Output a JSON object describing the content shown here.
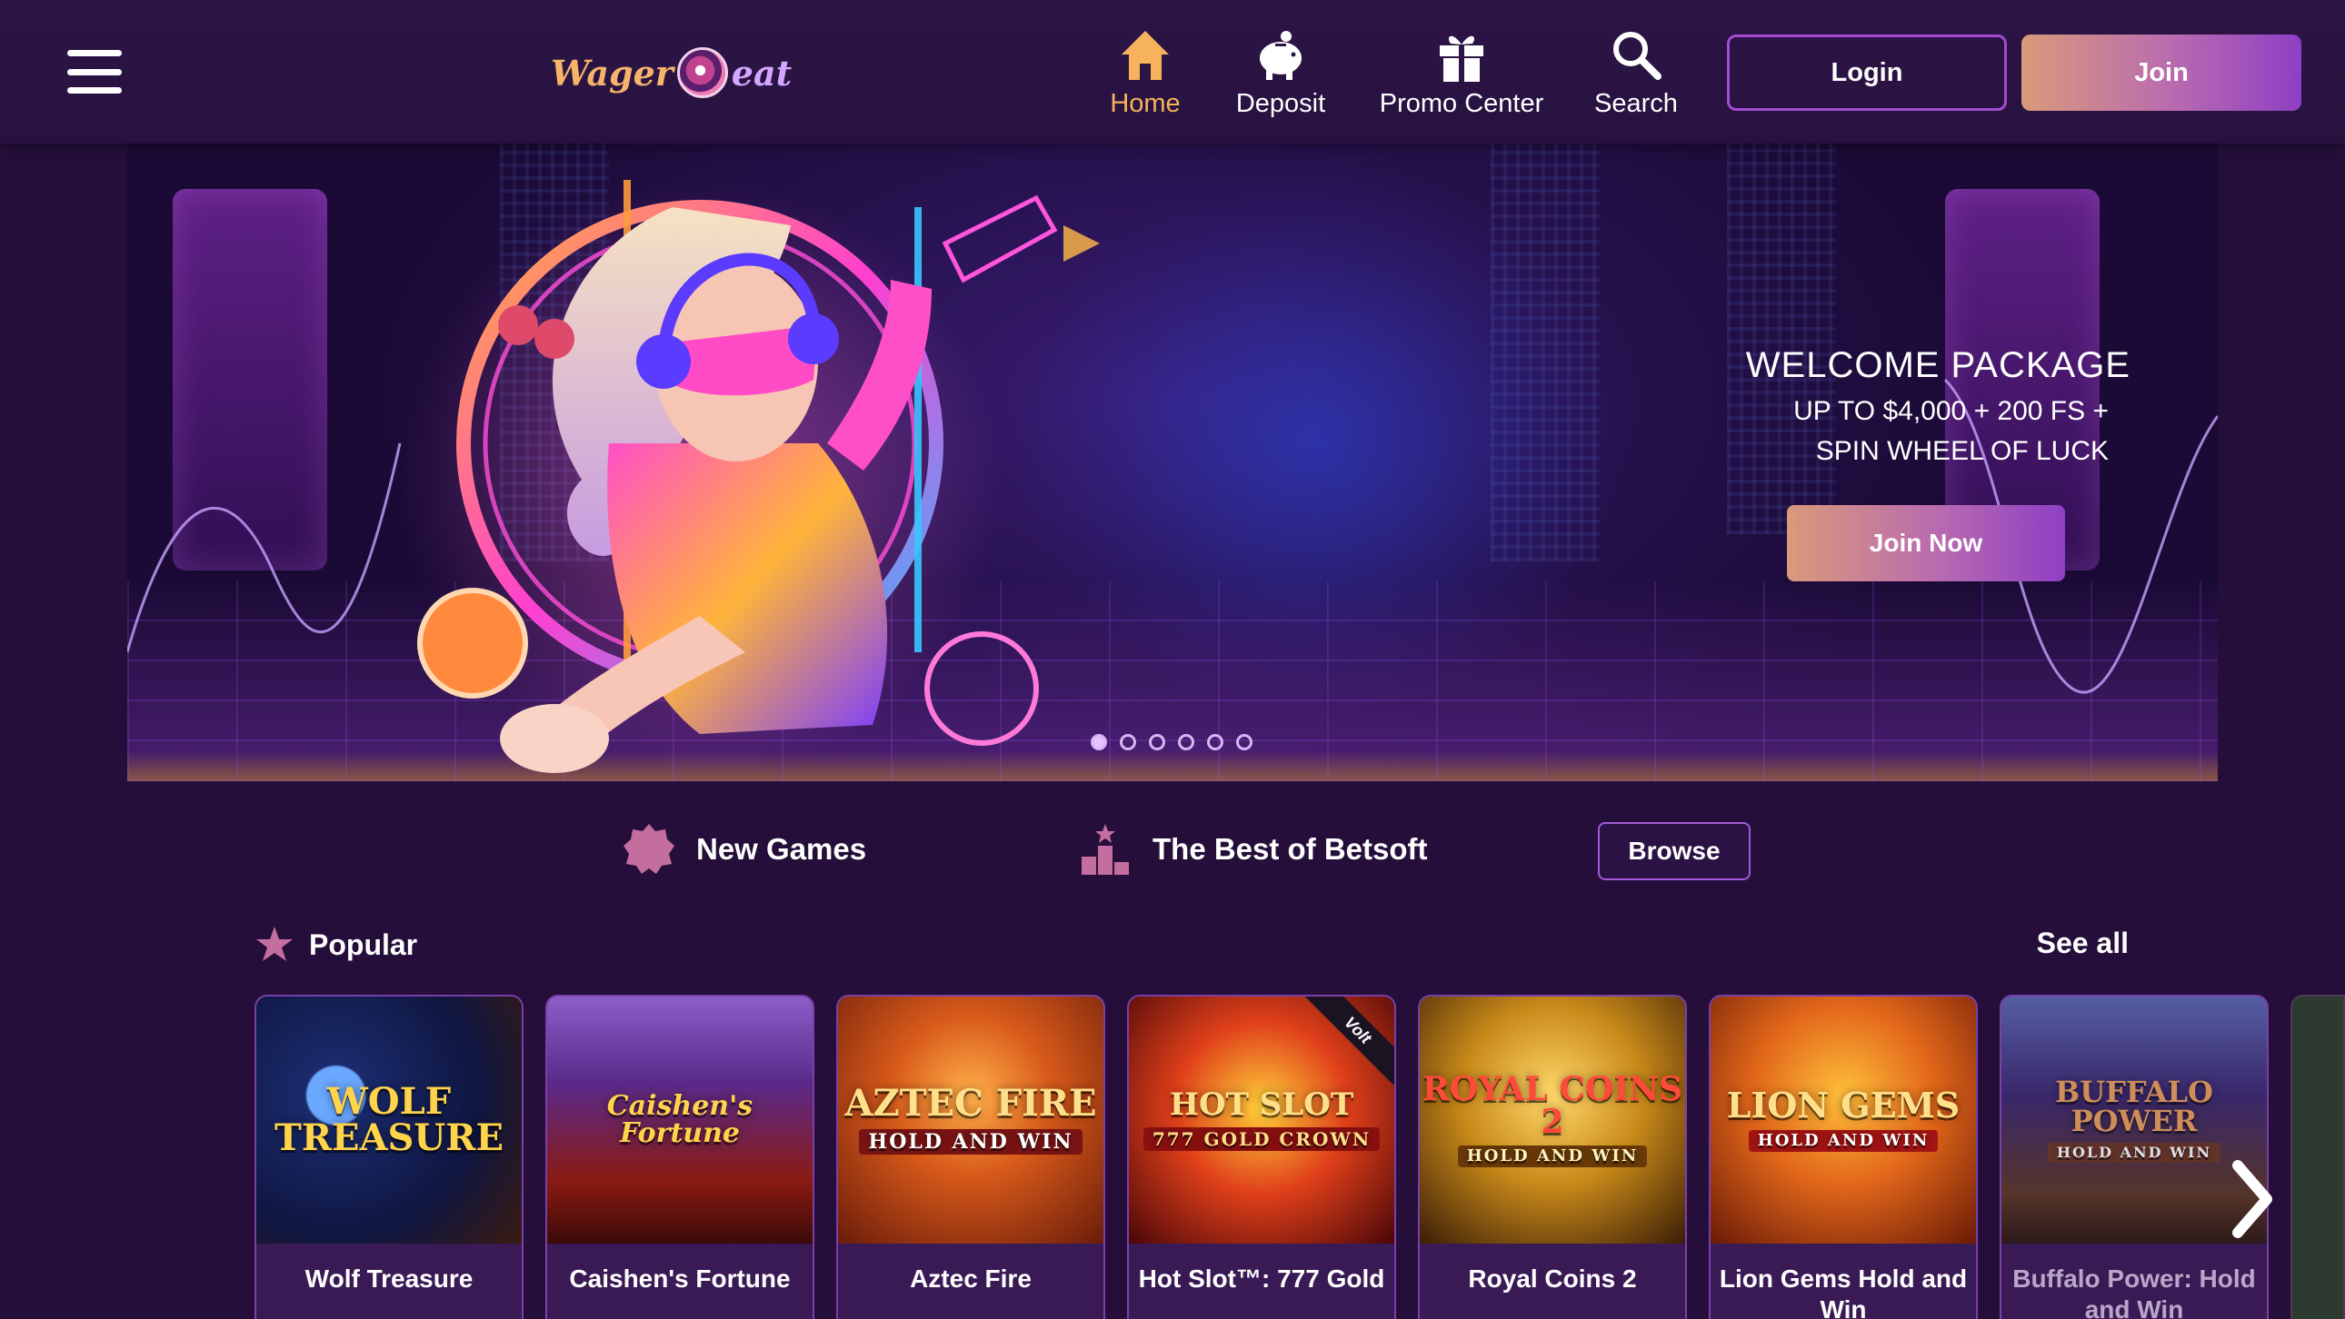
{
  "header": {
    "logo": {
      "part1": "Wager",
      "part2": "eat"
    },
    "nav": [
      {
        "id": "home",
        "label": "Home",
        "icon": "home-icon",
        "active": true
      },
      {
        "id": "deposit",
        "label": "Deposit",
        "icon": "piggy-bank-icon"
      },
      {
        "id": "promo",
        "label": "Promo Center",
        "icon": "gift-icon"
      },
      {
        "id": "search",
        "label": "Search",
        "icon": "search-icon"
      }
    ],
    "login_label": "Login",
    "join_label": "Join"
  },
  "hero": {
    "title": "WELCOME PACKAGE",
    "line1": "UP TO $4,000 + 200 FS +",
    "line2": "SPIN WHEEL OF LUCK",
    "cta": "Join Now",
    "slides_total": 6,
    "slide_active": 1
  },
  "categories": {
    "new_games": "New Games",
    "best_of": "The Best of Betsoft",
    "browse": "Browse"
  },
  "popular": {
    "title": "Popular",
    "see_all": "See all",
    "games": [
      {
        "name": "Wolf Treasure",
        "art_title": "WOLF TREASURE",
        "art_sub": ""
      },
      {
        "name": "Caishen's Fortune",
        "art_title": "Caishen's Fortune",
        "art_sub": ""
      },
      {
        "name": "Aztec Fire",
        "art_title": "AZTEC FIRE",
        "art_sub": "HOLD AND WIN"
      },
      {
        "name": "Hot Slot™: 777 Gold",
        "art_title": "HOT SLOT",
        "art_sub": "777 GOLD CROWN",
        "badge": "Volt"
      },
      {
        "name": "Royal Coins 2",
        "art_title": "ROYAL COINS 2",
        "art_sub": "HOLD AND WIN"
      },
      {
        "name": "Lion Gems Hold and Win",
        "art_title": "LION GEMS",
        "art_sub": "HOLD AND WIN"
      },
      {
        "name": "Buffalo Power: Hold and Win",
        "art_title": "BUFFALO POWER",
        "art_sub": "HOLD AND WIN"
      }
    ]
  },
  "colors": {
    "accent": "#f7b25c",
    "background": "#250f3a",
    "header": "#2c1545",
    "button_gradient_start": "#d99a7a",
    "button_gradient_end": "#8e3fc4",
    "login_border": "#a34bd3"
  }
}
